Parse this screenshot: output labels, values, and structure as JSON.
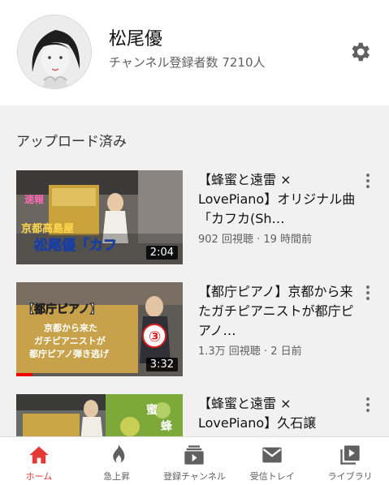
{
  "channel": {
    "name": "松尾優",
    "subscribers": "チャンネル登録者数 7210人"
  },
  "section": {
    "title": "アップロード済み"
  },
  "videos": [
    {
      "title": "【蜂蜜と遠雷 × LovePiano】オリジナル曲「カフカ(Sh…",
      "meta": "902 回視聴 · 19 時間前",
      "duration": "2:04",
      "thumb_text": [
        "京都高島屋",
        "松尾優「カフ"
      ]
    },
    {
      "title": "【都庁ピアノ】京都から来たガチピアニストが都庁ピアノ…",
      "meta": "1.3万 回視聴 · 2 日前",
      "duration": "3:32",
      "thumb_text": [
        "【都庁ピアノ】",
        "京都から来た",
        "ガチピアニストが",
        "都庁ピアノ弾き逃げ",
        "③"
      ]
    },
    {
      "title": "【蜂蜜と遠雷 × LovePiano】久石譲",
      "meta": "",
      "duration": "",
      "thumb_text": [
        "蜜",
        "蜂"
      ]
    }
  ],
  "tabs": [
    {
      "label": "ホーム",
      "icon": "home-icon",
      "active": true
    },
    {
      "label": "急上昇",
      "icon": "flame-icon",
      "active": false
    },
    {
      "label": "登録チャンネル",
      "icon": "subscriptions-icon",
      "active": false
    },
    {
      "label": "受信トレイ",
      "icon": "inbox-icon",
      "active": false
    },
    {
      "label": "ライブラリ",
      "icon": "library-icon",
      "active": false
    }
  ],
  "colors": {
    "accent": "#e53935",
    "icon_gray": "#606060"
  }
}
